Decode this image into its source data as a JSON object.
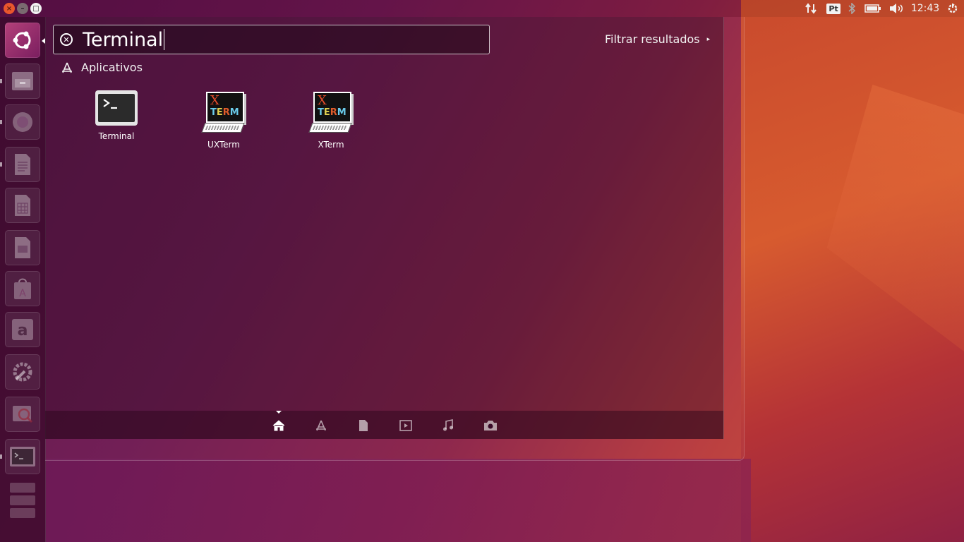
{
  "top_panel": {
    "window_buttons": {
      "close": "×",
      "minimize": "–",
      "maximize": "□"
    },
    "indicators": {
      "network_icon": "network-arrows-icon",
      "keyboard_layout": "Pt",
      "bluetooth_icon": "bluetooth-icon",
      "battery_icon": "battery-icon",
      "volume_icon": "volume-icon",
      "clock": "12:43",
      "system_icon": "gear-power-icon"
    }
  },
  "launcher": {
    "items": [
      {
        "name": "dash-home",
        "icon": "ubuntu-logo-icon"
      },
      {
        "name": "files",
        "icon": "file-cabinet-icon"
      },
      {
        "name": "firefox",
        "icon": "firefox-icon"
      },
      {
        "name": "writer",
        "icon": "document-icon"
      },
      {
        "name": "calc",
        "icon": "spreadsheet-icon"
      },
      {
        "name": "impress",
        "icon": "presentation-icon"
      },
      {
        "name": "software",
        "icon": "shopping-bag-icon"
      },
      {
        "name": "amazon",
        "icon": "amazon-icon"
      },
      {
        "name": "settings",
        "icon": "wrench-gear-icon"
      },
      {
        "name": "image-viewer",
        "icon": "magnifier-icon"
      },
      {
        "name": "terminal",
        "icon": "terminal-icon"
      },
      {
        "name": "workspaces",
        "icon": "stack-icon"
      }
    ]
  },
  "dash": {
    "search": {
      "value": "Terminal"
    },
    "filter_label": "Filtrar resultados",
    "category": "Aplicativos",
    "results": [
      {
        "label": "Terminal",
        "icon": "terminal-icon"
      },
      {
        "label": "UXTerm",
        "icon": "xterm-icon"
      },
      {
        "label": "XTerm",
        "icon": "xterm-icon"
      }
    ],
    "xterm_icon_text": {
      "x": "X",
      "term": "TERM"
    },
    "lenses": [
      {
        "name": "home",
        "icon": "home-icon"
      },
      {
        "name": "applications",
        "icon": "applications-icon"
      },
      {
        "name": "files",
        "icon": "file-icon"
      },
      {
        "name": "video",
        "icon": "video-icon"
      },
      {
        "name": "music",
        "icon": "music-icon"
      },
      {
        "name": "photos",
        "icon": "camera-icon"
      }
    ]
  }
}
